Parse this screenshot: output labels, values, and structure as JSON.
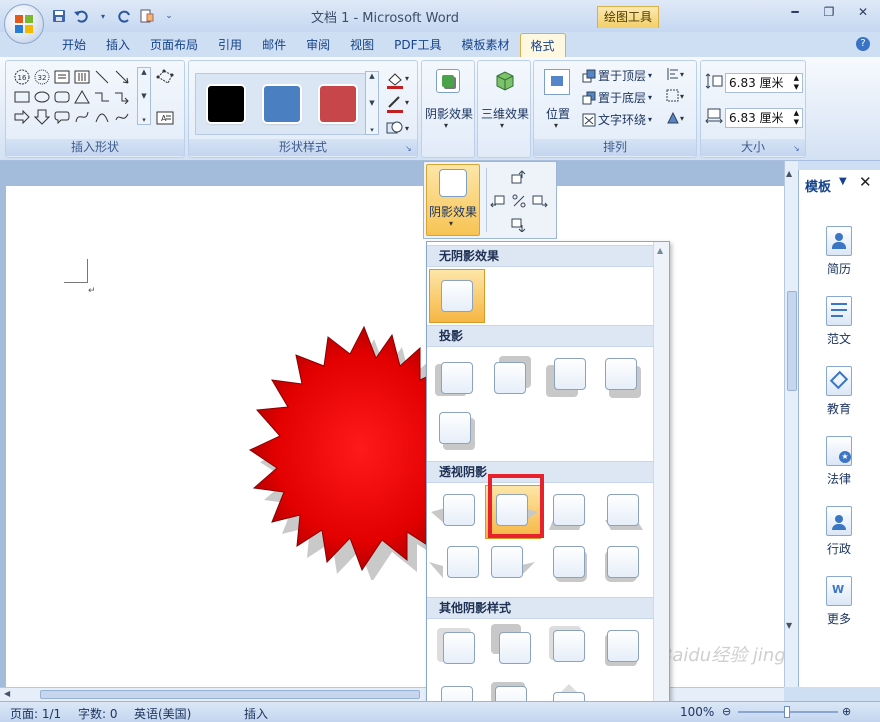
{
  "window": {
    "title": "文档 1 - Microsoft Word",
    "context_tab": "绘图工具"
  },
  "tabs": [
    "开始",
    "插入",
    "页面布局",
    "引用",
    "邮件",
    "审阅",
    "视图",
    "PDF工具",
    "模板素材",
    "格式"
  ],
  "active_tab": "格式",
  "ribbon": {
    "insert_shapes": {
      "label": "插入形状"
    },
    "shape_styles": {
      "label": "形状样式",
      "swatches": [
        "#000000",
        "#4a7fc1",
        "#c6464a"
      ]
    },
    "shadow_effects": {
      "label": "阴影效果"
    },
    "3d_effects": {
      "label": "三维效果"
    },
    "arrange": {
      "label": "排列",
      "position": "位置",
      "bring_front": "置于顶层",
      "send_back": "置于底层",
      "text_wrap": "文字环绕"
    },
    "size": {
      "label": "大小",
      "height": "6.83 厘米",
      "width": "6.83 厘米"
    }
  },
  "shadow_dropdown": {
    "button_label": "阴影效果",
    "sections": {
      "none": "无阴影效果",
      "drop": "投影",
      "perspective": "透视阴影",
      "other": "其他阴影样式"
    }
  },
  "template_pane": {
    "title": "模板",
    "items": [
      "简历",
      "范文",
      "教育",
      "法律",
      "行政",
      "更多"
    ]
  },
  "statusbar": {
    "page": "页面: 1/1",
    "words": "字数: 0",
    "lang": "英语(美国)",
    "mode": "插入",
    "zoom": "100%"
  },
  "watermark": "Baidu经验 jingyan.baidu.com"
}
